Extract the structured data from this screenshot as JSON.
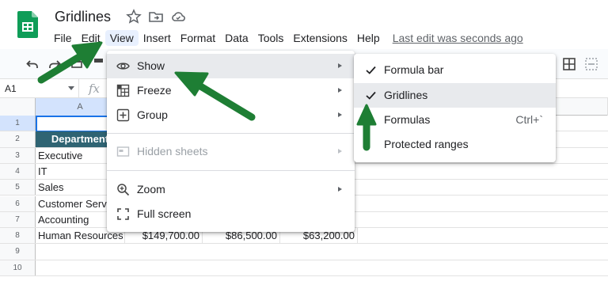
{
  "document": {
    "title": "Gridlines",
    "last_edit": "Last edit was seconds ago"
  },
  "menubar": {
    "items": [
      {
        "label": "File"
      },
      {
        "label": "Edit"
      },
      {
        "label": "View"
      },
      {
        "label": "Insert"
      },
      {
        "label": "Format"
      },
      {
        "label": "Data"
      },
      {
        "label": "Tools"
      },
      {
        "label": "Extensions"
      },
      {
        "label": "Help"
      }
    ],
    "active": "View"
  },
  "formula_bar": {
    "name_box": "A1",
    "fx": "fx"
  },
  "grid": {
    "columns": [
      "A"
    ],
    "row_numbers": [
      "1",
      "2",
      "3",
      "4",
      "5",
      "6",
      "7",
      "8",
      "9",
      "10"
    ],
    "cells": {
      "a2": "Department",
      "a3": "Executive",
      "a4": "IT",
      "a5": "Sales",
      "a6": "Customer Servi",
      "a7": "Accounting",
      "a8": "Human Resources",
      "b8": "$149,700.00",
      "c8": "$86,500.00",
      "d8": "$63,200.00"
    }
  },
  "view_menu": {
    "items": [
      {
        "label": "Show",
        "icon": "eye-icon",
        "has_submenu": true,
        "disabled": false
      },
      {
        "label": "Freeze",
        "icon": "freeze-grid-icon",
        "has_submenu": true,
        "disabled": false
      },
      {
        "label": "Group",
        "icon": "group-plus-icon",
        "has_submenu": true,
        "disabled": false
      },
      {
        "label": "Hidden sheets",
        "icon": "hidden-sheet-icon",
        "has_submenu": true,
        "disabled": true
      },
      {
        "label": "Zoom",
        "icon": "zoom-icon",
        "has_submenu": true,
        "disabled": false
      },
      {
        "label": "Full screen",
        "icon": "fullscreen-icon",
        "has_submenu": false,
        "disabled": false
      }
    ]
  },
  "show_submenu": {
    "items": [
      {
        "label": "Formula bar",
        "checked": true,
        "shortcut": ""
      },
      {
        "label": "Gridlines",
        "checked": true,
        "shortcut": ""
      },
      {
        "label": "Formulas",
        "checked": false,
        "shortcut": "Ctrl+`"
      },
      {
        "label": "Protected ranges",
        "checked": false,
        "shortcut": ""
      }
    ]
  },
  "colors": {
    "annotation_arrow": "#1e7e34",
    "header_fill": "#2f6473",
    "menu_highlight": "#e8eaed"
  }
}
